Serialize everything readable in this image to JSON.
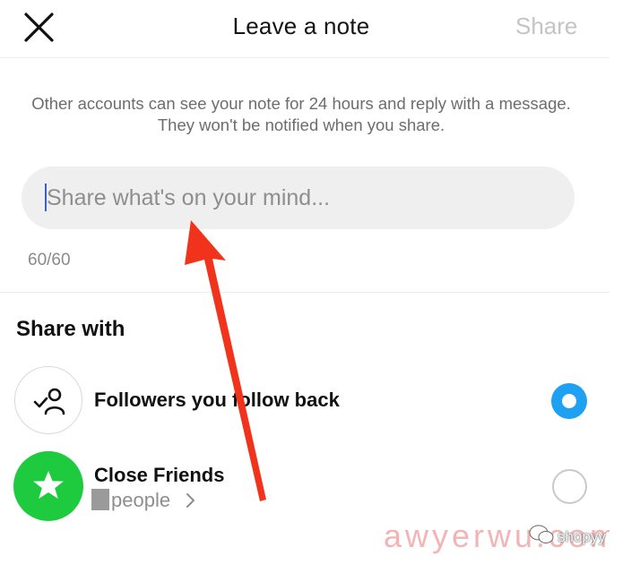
{
  "header": {
    "title": "Leave a note",
    "share_label": "Share",
    "close_icon": "close-icon"
  },
  "description": "Other accounts can see your note for 24 hours and reply with a message. They won't be notified when you share.",
  "note_input": {
    "value": "",
    "placeholder": "Share what's on your mind..."
  },
  "char_counter": "60/60",
  "share_with": {
    "heading": "Share with",
    "options": [
      {
        "label": "Followers you follow back",
        "icon": "followers-check-icon",
        "selected": true
      },
      {
        "label": "Close Friends",
        "sublabel": "people",
        "icon": "star-icon",
        "selected": false
      }
    ]
  },
  "colors": {
    "accent": "#1ea1f2",
    "close_friends_green": "#1ecb3e",
    "annotation_arrow": "#f2331b",
    "share_disabled": "#c4c4c4"
  },
  "watermark": {
    "text": "awyerwu.com",
    "brand": "shopyy"
  }
}
